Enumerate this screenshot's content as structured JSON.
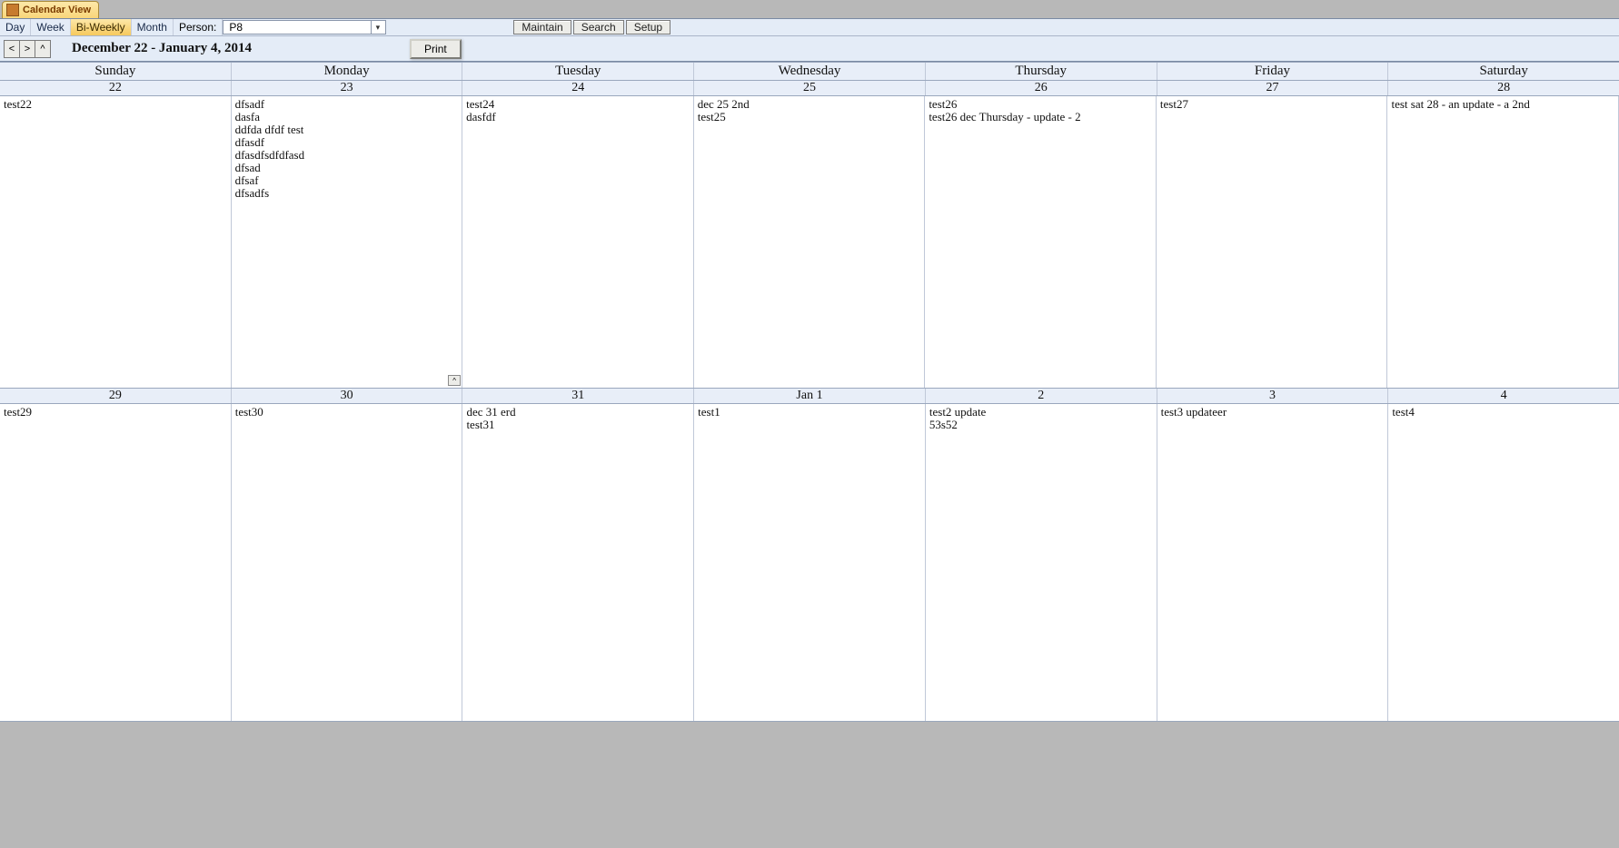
{
  "tab": {
    "title": "Calendar View"
  },
  "toolbar1": {
    "views": [
      "Day",
      "Week",
      "Bi-Weekly",
      "Month"
    ],
    "active_view_index": 2,
    "person_label": "Person:",
    "person_value": "P8",
    "buttons": {
      "maintain": "Maintain",
      "search": "Search",
      "setup": "Setup"
    }
  },
  "toolbar2": {
    "nav": {
      "prev": "<",
      "next": ">",
      "up": "^"
    },
    "range": "December 22 - January 4, 2014",
    "print": "Print"
  },
  "dow": [
    "Sunday",
    "Monday",
    "Tuesday",
    "Wednesday",
    "Thursday",
    "Friday",
    "Saturday"
  ],
  "weeks": [
    {
      "dates": [
        "22",
        "23",
        "24",
        "25",
        "26",
        "27",
        "28"
      ],
      "days": [
        {
          "entries": [
            "test22"
          ]
        },
        {
          "entries": [
            "dfsadf",
            "dasfa",
            "ddfda dfdf test",
            "dfasdf",
            "dfasdfsdfdfasd",
            "dfsad",
            "dfsaf",
            "dfsadfs"
          ]
        },
        {
          "entries": [
            "test24",
            "dasfdf"
          ]
        },
        {
          "entries": [
            "dec 25 2nd",
            "test25"
          ]
        },
        {
          "entries": [
            "test26",
            "test26 dec Thursday - update - 2"
          ]
        },
        {
          "entries": [
            "test27"
          ]
        },
        {
          "entries": [
            "test sat 28 - an update - a 2nd"
          ]
        }
      ]
    },
    {
      "dates": [
        "29",
        "30",
        "31",
        "Jan 1",
        "2",
        "3",
        "4"
      ],
      "days": [
        {
          "entries": [
            "test29"
          ]
        },
        {
          "entries": [
            "test30"
          ]
        },
        {
          "entries": [
            "dec 31 erd",
            "test31"
          ]
        },
        {
          "entries": [
            "test1"
          ]
        },
        {
          "entries": [
            "test2 update",
            "53s52"
          ]
        },
        {
          "entries": [
            "test3 updateer"
          ]
        },
        {
          "entries": [
            "test4"
          ]
        }
      ]
    }
  ]
}
